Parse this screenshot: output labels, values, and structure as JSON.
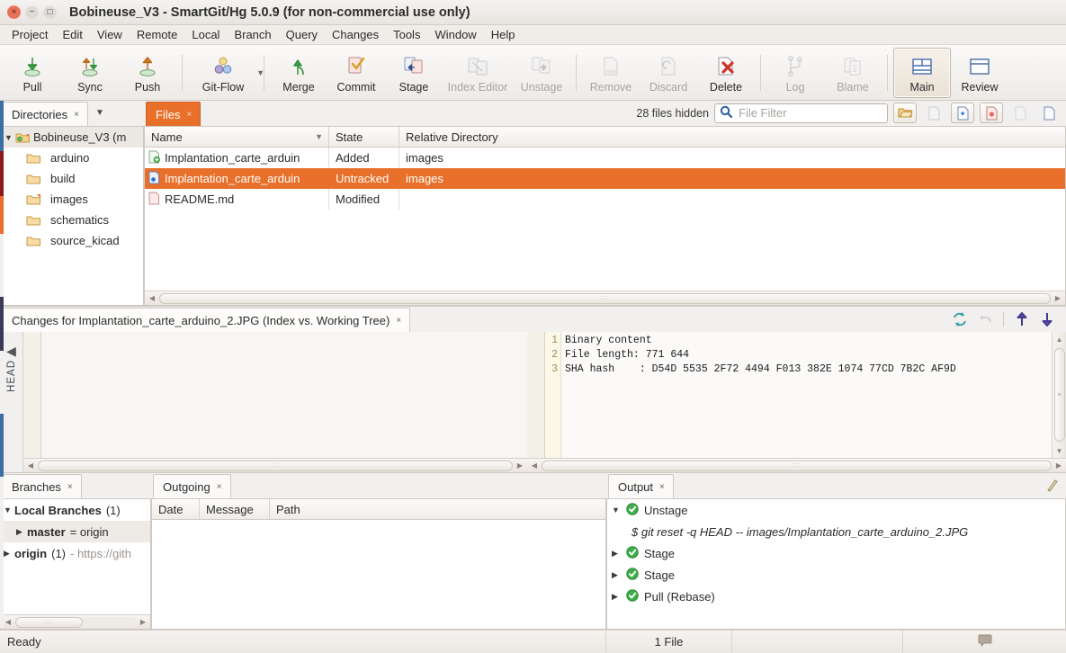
{
  "window": {
    "title": "Bobineuse_V3 - SmartGit/Hg 5.0.9 (for non-commercial use only)",
    "close_glyph": "×",
    "min_glyph": "−",
    "max_glyph": "□"
  },
  "menubar": {
    "items": [
      "Project",
      "Edit",
      "View",
      "Remote",
      "Local",
      "Branch",
      "Query",
      "Changes",
      "Tools",
      "Window",
      "Help"
    ]
  },
  "toolbar": {
    "buttons": [
      {
        "label": "Pull",
        "icon": "pull-icon",
        "enabled": true
      },
      {
        "label": "Sync",
        "icon": "sync-icon",
        "enabled": true
      },
      {
        "label": "Push",
        "icon": "push-icon",
        "enabled": true
      },
      {
        "label": "Git-Flow",
        "icon": "git-flow-icon",
        "enabled": true,
        "dropdown": true
      },
      {
        "label": "Merge",
        "icon": "merge-icon",
        "enabled": true
      },
      {
        "label": "Commit",
        "icon": "commit-icon",
        "enabled": true
      },
      {
        "label": "Stage",
        "icon": "stage-icon",
        "enabled": true
      },
      {
        "label": "Index Editor",
        "icon": "index-editor-icon",
        "enabled": false
      },
      {
        "label": "Unstage",
        "icon": "unstage-icon",
        "enabled": false
      },
      {
        "label": "Remove",
        "icon": "remove-icon",
        "enabled": false
      },
      {
        "label": "Discard",
        "icon": "discard-icon",
        "enabled": false
      },
      {
        "label": "Delete",
        "icon": "delete-icon",
        "enabled": true
      },
      {
        "label": "Log",
        "icon": "log-icon",
        "enabled": false
      },
      {
        "label": "Blame",
        "icon": "blame-icon",
        "enabled": false
      },
      {
        "label": "Main",
        "icon": "main-layout-icon",
        "enabled": true,
        "active": true
      },
      {
        "label": "Review",
        "icon": "review-layout-icon",
        "enabled": true
      }
    ]
  },
  "directories": {
    "tab_label": "Directories",
    "tab_close": "×",
    "root": {
      "label": "Bobineuse_V3 (m",
      "twisty": "▼"
    },
    "items": [
      {
        "label": "arduino",
        "modified": false
      },
      {
        "label": "build",
        "modified": false
      },
      {
        "label": "images",
        "modified": true
      },
      {
        "label": "schematics",
        "modified": false
      },
      {
        "label": "source_kicad",
        "modified": false
      }
    ]
  },
  "files": {
    "tab_label": "Files",
    "tab_close": "×",
    "hidden_label": "28 files hidden",
    "filter_placeholder": "File Filter",
    "filter_value": "",
    "columns": [
      "Name",
      "State",
      "Relative Directory"
    ],
    "sort_caret": "▼",
    "rows": [
      {
        "name": "Implantation_carte_arduin",
        "state": "Added",
        "relative_directory": "images",
        "icon": "file-added-icon",
        "selected": false
      },
      {
        "name": "Implantation_carte_arduin",
        "state": "Untracked",
        "relative_directory": "images",
        "icon": "file-untracked-icon",
        "selected": true
      },
      {
        "name": "README.md",
        "state": "Modified",
        "relative_directory": "",
        "icon": "file-modified-icon",
        "selected": false
      }
    ]
  },
  "changes": {
    "tab_label": "Changes for Implantation_carte_arduino_2.JPG (Index vs. Working Tree)",
    "tab_close": "×",
    "head_label": "HEAD",
    "head_triangle": "◀",
    "actions": [
      {
        "name": "refresh-icon",
        "enabled": true
      },
      {
        "name": "undo-icon",
        "enabled": false
      },
      {
        "name": "previous-change-icon",
        "enabled": true
      },
      {
        "name": "next-change-icon",
        "enabled": true
      }
    ],
    "left_lines": [],
    "right_lines": [
      {
        "num": "1",
        "text": "Binary content"
      },
      {
        "num": "2",
        "text": "File length: 771 644"
      },
      {
        "num": "3",
        "text": "SHA hash    : D54D 5535 2F72 4494 F013 382E 1074 77CD 7B2C AF9D"
      }
    ]
  },
  "branches": {
    "tab_label": "Branches",
    "tab_close": "×",
    "rows": [
      {
        "twisty": "▼",
        "label": "Local Branches",
        "count": "(1)",
        "indent": 0,
        "selected": false
      },
      {
        "twisty": "▶",
        "label": "master",
        "suffix": "= origin",
        "indent": 1,
        "selected": true
      },
      {
        "twisty": "▶",
        "label": "origin",
        "count": "(1)",
        "url": "- https://gith",
        "indent": 0,
        "selected": false
      }
    ]
  },
  "outgoing": {
    "tab_label": "Outgoing",
    "tab_close": "×",
    "columns": [
      "Date",
      "Message",
      "Path"
    ],
    "rows": []
  },
  "output": {
    "tab_label": "Output",
    "tab_close": "×",
    "clear_icon": "clear-output-icon",
    "rows": [
      {
        "twisty": "▼",
        "status": "ok",
        "label": "Unstage",
        "type": "group"
      },
      {
        "type": "command",
        "label": "$ git reset -q HEAD -- images/Implantation_carte_arduino_2.JPG"
      },
      {
        "twisty": "▶",
        "status": "ok",
        "label": "Stage",
        "type": "group"
      },
      {
        "twisty": "▶",
        "status": "ok",
        "label": "Stage",
        "type": "group"
      },
      {
        "twisty": "▶",
        "status": "ok",
        "label": "Pull (Rebase)",
        "type": "group"
      }
    ]
  },
  "statusbar": {
    "ready": "Ready",
    "file_count": "1 File",
    "middle": "",
    "right_icon": "message-icon"
  },
  "colors": {
    "accent": "#e8702a",
    "selection": "#e8702a",
    "ok_green": "#3fae4a",
    "window_bg": "#f2f0ee",
    "link": "#9a9490"
  }
}
